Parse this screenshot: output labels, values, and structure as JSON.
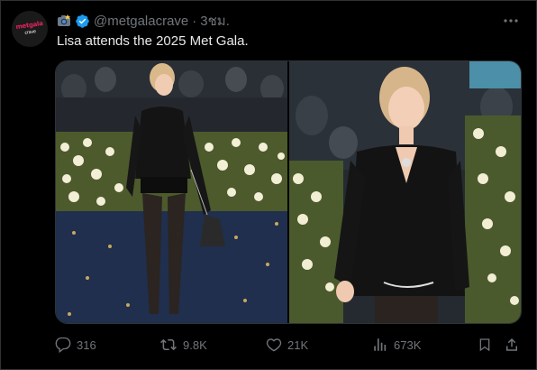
{
  "tweet": {
    "avatar_name": "metgalacrave logo",
    "avatar_logo_line1": "metgala",
    "avatar_logo_line2": "crave",
    "handle": "@metgalacrave",
    "separator": "·",
    "time": "3ชม.",
    "text": "Lisa attends the 2025 Met Gala.",
    "verified_color": "#1d9bf0"
  },
  "media": {
    "photos": [
      {
        "name": "photo-left",
        "description_icon": "image"
      },
      {
        "name": "photo-right",
        "description_icon": "image"
      }
    ]
  },
  "actions": {
    "replies": "316",
    "reposts": "9.8K",
    "likes": "21K",
    "views": "673K"
  },
  "icons": [
    "camera-emoji-icon",
    "verified-badge-icon",
    "more-icon",
    "reply-icon",
    "repost-icon",
    "like-icon",
    "views-icon",
    "bookmark-icon",
    "share-icon"
  ]
}
